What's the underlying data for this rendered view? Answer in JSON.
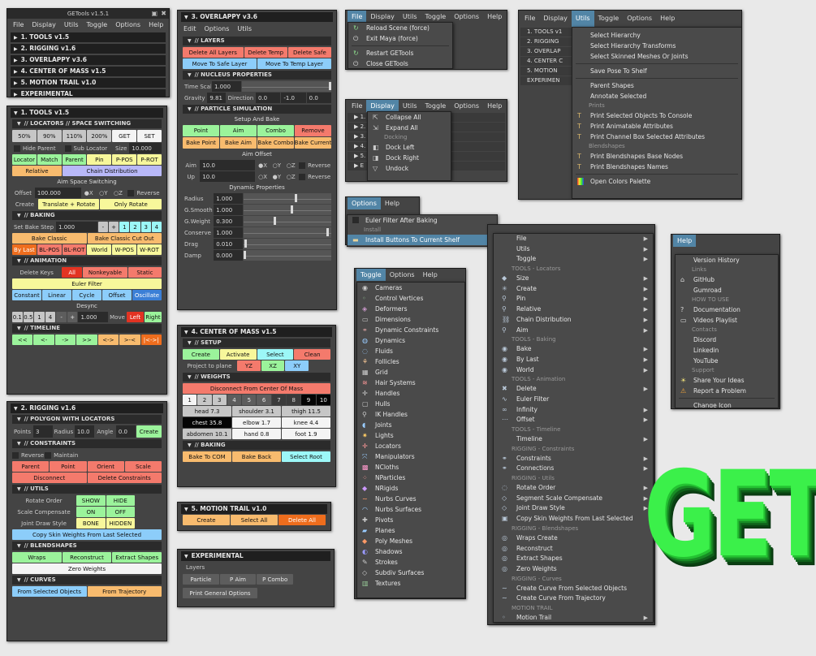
{
  "main": {
    "title": "GETools v1.5.1",
    "menu": [
      "File",
      "Display",
      "Utils",
      "Toggle",
      "Options",
      "Help"
    ],
    "sections": [
      "1. TOOLS v1.5",
      "2. RIGGING v1.6",
      "3. OVERLAPPY v3.6",
      "4. CENTER OF MASS v1.5",
      "5. MOTION TRAIL v1.0",
      "EXPERIMENTAL"
    ]
  },
  "tools": {
    "header": "1. TOOLS v1.5",
    "loc_title": "// LOCATORS // SPACE SWITCHING",
    "pct": [
      "50%",
      "90%",
      "110%",
      "200%",
      "GET",
      "SET"
    ],
    "hide_parent": "Hide Parent",
    "sub_locator": "Sub Locator",
    "size_label": "Size",
    "size": "10.000",
    "loc_row": [
      "Locator",
      "Match",
      "Parent",
      "Pin",
      "P-POS",
      "P-ROT"
    ],
    "relative": "Relative",
    "chain": "Chain Distribution",
    "aim_title": "Aim Space Switching",
    "offset_label": "Offset",
    "offset": "100.000",
    "axes": [
      "X",
      "Y",
      "Z"
    ],
    "reverse": "Reverse",
    "create_label": "Create",
    "translate_rotate": "Translate + Rotate",
    "only_rotate": "Only Rotate",
    "baking_title": "// BAKING",
    "set_bake_step": "Set Bake Step",
    "bake_step": "1.000",
    "bake_nums": [
      "-",
      "+",
      "1",
      "2",
      "3",
      "4"
    ],
    "bake_classic": "Bake Classic",
    "bake_cut": "Bake Classic Cut Out",
    "bake_row": [
      "By Last",
      "BL-POS",
      "BL-ROT",
      "World",
      "W-POS",
      "W-ROT"
    ],
    "anim_title": "// ANIMATION",
    "delete_keys": "Delete Keys",
    "del_row": [
      "All",
      "Nonkeyable",
      "Static"
    ],
    "euler": "Euler Filter",
    "curve_row": [
      "Constant",
      "Linear",
      "Cycle",
      "Offset",
      "Oscillate"
    ],
    "desync": "Desync",
    "desync_row": [
      "0.1",
      "0.5",
      "1",
      "4",
      "-",
      "+"
    ],
    "desync_val": "1.000",
    "move": "Move",
    "left": "Left",
    "right": "Right",
    "timeline_title": "// TIMELINE",
    "timeline": [
      "<<",
      "<-",
      "->",
      ">>",
      "<->",
      ">-<",
      "|<->|"
    ]
  },
  "rigging": {
    "header": "2. RIGGING v1.6",
    "poly_title": "// POLYGON WITH LOCATORS",
    "points_label": "Points",
    "points": "3",
    "radius_label": "Radius",
    "radius": "10.0",
    "angle_label": "Angle",
    "angle": "0.0",
    "create": "Create",
    "constraints_title": "// CONSTRAINTS",
    "reverse": "Reverse",
    "maintain": "Maintain",
    "cons_row": [
      "Parent",
      "Point",
      "Orient",
      "Scale"
    ],
    "disconnect": "Disconnect",
    "delete_constraints": "Delete Constraints",
    "utils_title": "// UTILS",
    "rotate_order": "Rotate Order",
    "scale_comp": "Scale Compensate",
    "joint_draw": "Joint Draw Style",
    "show": "SHOW",
    "hide": "HIDE",
    "on": "ON",
    "off": "OFF",
    "bone": "BONE",
    "hidden": "HIDDEN",
    "copy_skin": "Copy Skin Weights From Last Selected",
    "blend_title": "// BLENDSHAPES",
    "wraps": "Wraps",
    "reconstruct": "Reconstruct",
    "extract": "Extract Shapes",
    "zero": "Zero Weights",
    "curves_title": "// CURVES",
    "from_sel": "From Selected Objects",
    "from_traj": "From Trajectory"
  },
  "overlap": {
    "header": "3. OVERLAPPY v3.6",
    "menu": [
      "Edit",
      "Options",
      "Utils"
    ],
    "layers_title": "// LAYERS",
    "del_all": "Delete All Layers",
    "del_temp": "Delete Temp",
    "del_safe": "Delete Safe",
    "to_safe": "Move To Safe Layer",
    "to_temp": "Move To Temp Layer",
    "nucleus_title": "// NUCLEUS PROPERTIES",
    "time_scale": "Time Scale",
    "time_scale_val": "1.000",
    "gravity": "Gravity",
    "gravity_val": "9.81",
    "direction": "Direction",
    "dir_vals": [
      "0.0",
      "-1.0",
      "0.0"
    ],
    "particle_title": "// PARTICLE SIMULATION",
    "setup_bake": "Setup And Bake",
    "p_row": [
      "Point",
      "Aim",
      "Combo",
      "Remove"
    ],
    "b_row": [
      "Bake Point",
      "Bake Aim",
      "Bake Combo",
      "Bake Current"
    ],
    "aim_offset": "Aim Offset",
    "aim_label": "Aim",
    "aim_val": "10.0",
    "up_label": "Up",
    "up_val": "10.0",
    "axes": [
      "X",
      "Y",
      "Z"
    ],
    "reverse": "Reverse",
    "dyn_title": "Dynamic Properties",
    "dyn": [
      {
        "k": "Radius",
        "v": "1.000",
        "p": 0.6
      },
      {
        "k": "G.Smooth",
        "v": "1.000",
        "p": 0.55
      },
      {
        "k": "G.Weight",
        "v": "0.300",
        "p": 0.35
      },
      {
        "k": "Conserve",
        "v": "1.000",
        "p": 0.97
      },
      {
        "k": "Drag",
        "v": "0.010",
        "p": 0.01
      },
      {
        "k": "Damp",
        "v": "0.000",
        "p": 0.0
      }
    ]
  },
  "com": {
    "header": "4. CENTER OF MASS v1.5",
    "setup_title": "// SETUP",
    "setup_row": [
      "Create",
      "Activate",
      "Select",
      "Clean"
    ],
    "project": "Project to plane",
    "planes": [
      "YZ",
      "XZ",
      "XY"
    ],
    "weights_title": "// WEIGHTS",
    "disconnect": "Disconnect From Center Of Mass",
    "nums": [
      "1",
      "2",
      "3",
      "4",
      "5",
      "6",
      "7",
      "8",
      "9",
      "10"
    ],
    "parts": [
      "head 7.3",
      "shoulder 3.1",
      "thigh 11.5",
      "chest 35.8",
      "elbow 1.7",
      "knee 4.4",
      "abdomen 10.1",
      "hand 0.8",
      "foot 1.9"
    ],
    "baking_title": "// BAKING",
    "to_com": "Bake To COM",
    "bake_back": "Bake Back",
    "select_root": "Select Root"
  },
  "trail": {
    "header": "5. MOTION TRAIL v1.0",
    "create": "Create",
    "select_all": "Select All",
    "delete_all": "Delete All"
  },
  "exp": {
    "header": "EXPERIMENTAL",
    "layers": "Layers",
    "btns": [
      "Particle",
      "P Aim",
      "P Combo"
    ],
    "print": "Print General Options"
  },
  "file_menu": {
    "bar": [
      "File",
      "Display",
      "Utils",
      "Toggle",
      "Options",
      "Help"
    ],
    "items": [
      "Reload Scene (force)",
      "Exit Maya (force)",
      "Restart GETools",
      "Close GETools"
    ]
  },
  "display_menu": {
    "bar": [
      "File",
      "Display",
      "Utils",
      "Toggle",
      "Options",
      "Help"
    ],
    "items": [
      "Collapse All",
      "Expand All"
    ],
    "docking": "Docking",
    "dock": [
      "Dock Left",
      "Dock Right",
      "Undock"
    ]
  },
  "utils_menu": {
    "bar": [
      "File",
      "Display",
      "Utils",
      "Toggle",
      "Options",
      "Help"
    ],
    "sections": [
      "1. TOOLS v1",
      "2. RIGGING",
      "3. OVERLAP",
      "4. CENTER C",
      "5. MOTION",
      "EXPERIMEN"
    ],
    "items": [
      "Select Hierarchy",
      "Select Hierarchy Transforms",
      "Select Skinned Meshes Or Joints",
      "Save Pose To Shelf",
      "Parent Shapes",
      "Annotate Selected"
    ],
    "prints": "Prints",
    "print_items": [
      "Print Selected Objects To Console",
      "Print Animatable Attributes",
      "Print Channel Box Selected Attributes"
    ],
    "blend": "Blendshapes",
    "blend_items": [
      "Print Blendshapes Base Nodes",
      "Print Blendshapes Names"
    ],
    "palette": "Open Colors Palette"
  },
  "options_menu": {
    "bar": [
      "Options",
      "Help"
    ],
    "euler": "Euler Filter After Baking",
    "install": "Install",
    "install_item": "Install Buttons To Current Shelf"
  },
  "shelf_menu": {
    "items": [
      {
        "t": "i",
        "l": "File"
      },
      {
        "t": "i",
        "l": "Utils"
      },
      {
        "t": "i",
        "l": "Toggle"
      },
      {
        "t": "h",
        "l": "TOOLS - Locators"
      },
      {
        "t": "i",
        "l": "Size"
      },
      {
        "t": "i",
        "l": "Create"
      },
      {
        "t": "i",
        "l": "Pin"
      },
      {
        "t": "i",
        "l": "Relative"
      },
      {
        "t": "i",
        "l": "Chain Distribution"
      },
      {
        "t": "i",
        "l": "Aim"
      },
      {
        "t": "h",
        "l": "TOOLS - Baking"
      },
      {
        "t": "i",
        "l": "Bake"
      },
      {
        "t": "i",
        "l": "By Last"
      },
      {
        "t": "i",
        "l": "World"
      },
      {
        "t": "h",
        "l": "TOOLS - Animation"
      },
      {
        "t": "i",
        "l": "Delete"
      },
      {
        "t": "i",
        "l": "Euler Filter"
      },
      {
        "t": "i",
        "l": "Infinity"
      },
      {
        "t": "i",
        "l": "Offset"
      },
      {
        "t": "h",
        "l": "TOOLS - Timeline"
      },
      {
        "t": "i",
        "l": "Timeline"
      },
      {
        "t": "h",
        "l": "RIGGING - Constraints"
      },
      {
        "t": "i",
        "l": "Constraints"
      },
      {
        "t": "i",
        "l": "Connections"
      },
      {
        "t": "h",
        "l": "RIGGING - Utils"
      },
      {
        "t": "i",
        "l": "Rotate Order"
      },
      {
        "t": "i",
        "l": "Segment Scale Compensate"
      },
      {
        "t": "i",
        "l": "Joint Draw Style"
      },
      {
        "t": "i",
        "l": "Copy Skin Weights From Last Selected"
      },
      {
        "t": "h",
        "l": "RIGGING - Blendshapes"
      },
      {
        "t": "i",
        "l": "Wraps Create"
      },
      {
        "t": "i",
        "l": "Reconstruct"
      },
      {
        "t": "i",
        "l": "Extract Shapes"
      },
      {
        "t": "i",
        "l": "Zero Weights"
      },
      {
        "t": "h",
        "l": "RIGGING - Curves"
      },
      {
        "t": "i",
        "l": "Create Curve From Selected Objects"
      },
      {
        "t": "i",
        "l": "Create Curve From Trajectory"
      },
      {
        "t": "h",
        "l": "MOTION TRAIL"
      },
      {
        "t": "i",
        "l": "Motion Trail"
      }
    ]
  },
  "toggle_menu": {
    "bar": [
      "Toggle",
      "Options",
      "Help"
    ],
    "items": [
      "Cameras",
      "Control Vertices",
      "Deformers",
      "Dimensions",
      "Dynamic Constraints",
      "Dynamics",
      "Fluids",
      "Follicles",
      "Grid",
      "Hair Systems",
      "Handles",
      "Hulls",
      "IK Handles",
      "Joints",
      "Lights",
      "Locators",
      "Manipulators",
      "NCloths",
      "NParticles",
      "NRigids",
      "Nurbs Curves",
      "Nurbs Surfaces",
      "Pivots",
      "Planes",
      "Poly Meshes",
      "Shadows",
      "Strokes",
      "Subdiv Surfaces",
      "Textures"
    ]
  },
  "help_menu": {
    "bar": "Help",
    "version": "Version History",
    "links": "Links",
    "github": "GitHub",
    "gumroad": "Gumroad",
    "howto": "HOW TO USE",
    "docs": "Documentation",
    "videos": "Videos Playlist",
    "contacts": "Contacts",
    "discord": "Discord",
    "linkedin": "Linkedin",
    "youtube": "YouTube",
    "support": "Support",
    "share": "Share Your Ideas",
    "report": "Report a Problem",
    "change_icon": "Change Icon"
  },
  "logo": {
    "text": "GET",
    "color": "#3bf04a"
  },
  "colors": {
    "panel": "#444444",
    "header": "#1f1f1f",
    "highlight": "#5285a6",
    "green": "#9bf39b",
    "red": "#f47a6c",
    "yellow": "#f7f79b",
    "orange": "#f8bb6e",
    "blue": "#8ccdfa"
  }
}
